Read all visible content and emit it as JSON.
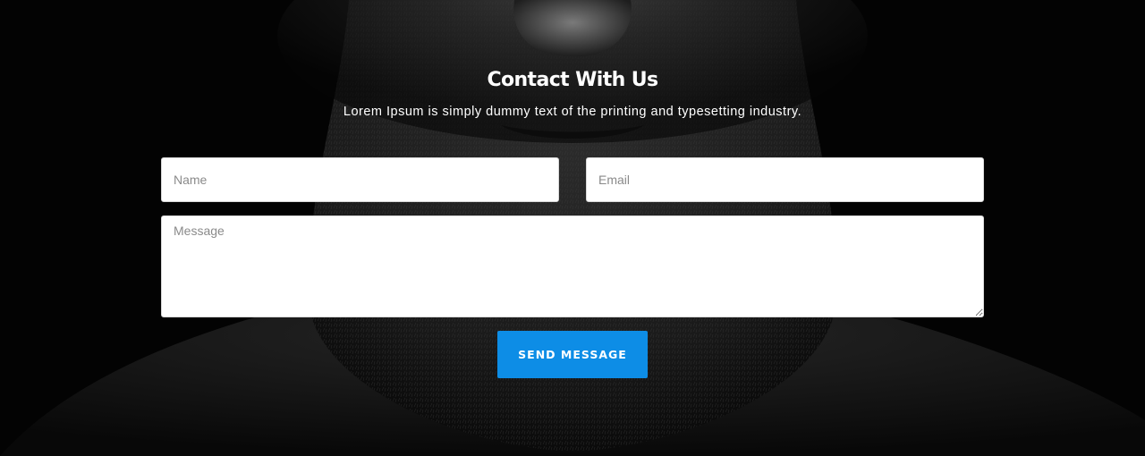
{
  "contact": {
    "title": "Contact With Us",
    "subtitle": "Lorem Ipsum is simply dummy text of the printing and typesetting industry."
  },
  "form": {
    "name_placeholder": "Name",
    "email_placeholder": "Email",
    "message_placeholder": "Message",
    "submit_label": "SEND MESSAGE"
  },
  "colors": {
    "background": "#030303",
    "accent": "#0d8de6",
    "text": "#ffffff"
  }
}
